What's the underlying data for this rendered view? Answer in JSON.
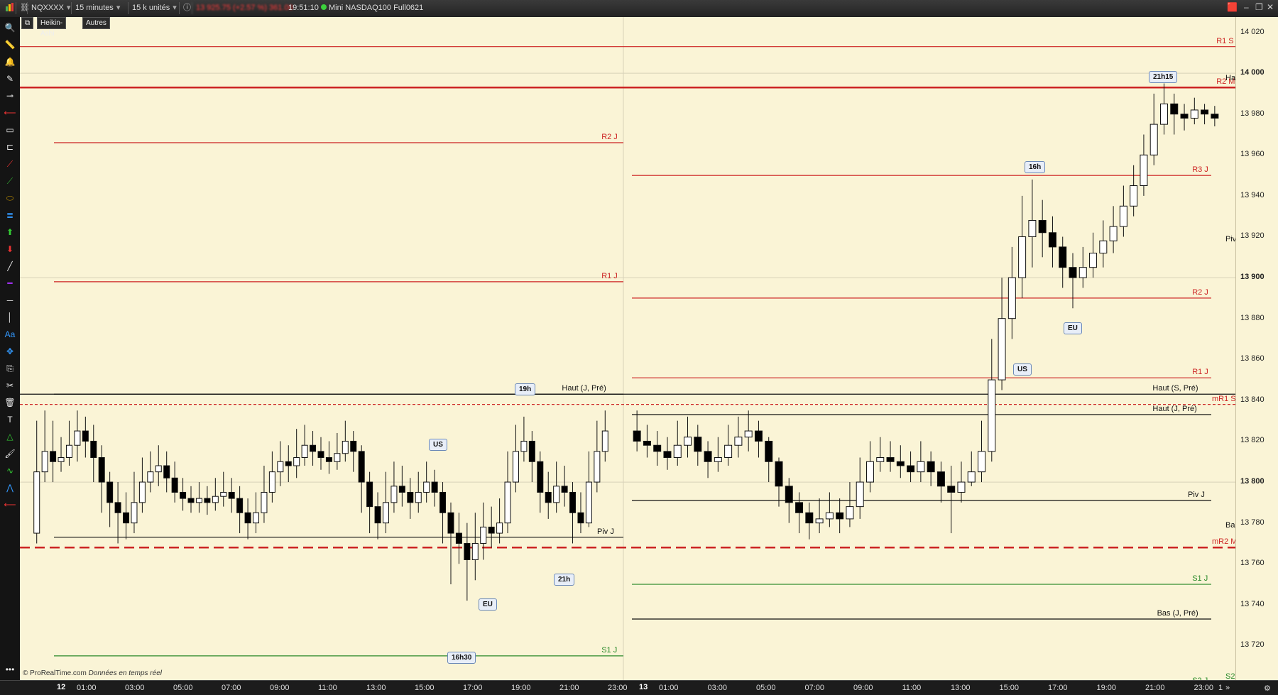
{
  "topbar": {
    "symbol": "NQXXXX",
    "timeframe": "15 minutes",
    "units": "15 k unités",
    "info_icon": "info-icon",
    "price_blur": "13 925.75 (+2.57 %) 361.00",
    "clock": "19:51:10",
    "instrument": "Mini NASDAQ100 Full0621"
  },
  "chart_header": {
    "mode": "Heikin-Ashi",
    "other": "Autres"
  },
  "copyright": "© ProRealTime.com",
  "copyright_note": "Données en temps réel",
  "yaxis": {
    "ticks": [
      "14 020",
      "14 000",
      "13 980",
      "13 960",
      "13 940",
      "13 920",
      "13 900",
      "13 880",
      "13 860",
      "13 840",
      "13 820",
      "13 800",
      "13 780",
      "13 760",
      "13 740",
      "13 720"
    ],
    "bold_ticks": [
      "14 000",
      "13 900",
      "13 800"
    ]
  },
  "xaxis": {
    "day1": "12",
    "day2": "13",
    "labels1": [
      "01:00",
      "03:00",
      "05:00",
      "07:00",
      "09:00",
      "11:00",
      "13:00",
      "15:00",
      "17:00",
      "19:00",
      "21:00",
      "23:00"
    ],
    "labels2": [
      "01:00",
      "03:00",
      "05:00",
      "07:00",
      "09:00",
      "11:00",
      "13:00",
      "15:00",
      "17:00",
      "19:00",
      "21:00",
      "23:00"
    ],
    "trailing": "1"
  },
  "levels": {
    "left": [
      {
        "label": "R2 J",
        "price": 13966,
        "color": "#cc2222"
      },
      {
        "label": "R1 J",
        "price": 13898,
        "color": "#cc2222"
      },
      {
        "label": "Haut (J, Pré)",
        "price": 13843,
        "color": "#111111"
      },
      {
        "label": "Piv J",
        "price": 13773,
        "color": "#111111"
      },
      {
        "label": "S1 J",
        "price": 13715,
        "color": "#2a8a2a"
      }
    ],
    "right": [
      {
        "label": "R1 S",
        "price": 14013,
        "color": "#cc2222"
      },
      {
        "label": "R2 M",
        "price": 13993,
        "color": "#cc2222"
      },
      {
        "label": "R3 J",
        "price": 13950,
        "color": "#cc2222"
      },
      {
        "label": "R2 J",
        "price": 13890,
        "color": "#cc2222"
      },
      {
        "label": "R1 J",
        "price": 13851,
        "color": "#cc2222"
      },
      {
        "label": "Haut (S, Pré)",
        "price": 13843,
        "color": "#111111"
      },
      {
        "label": "mR1 S",
        "price": 13838,
        "color": "#cc2222"
      },
      {
        "label": "Haut (J, Pré)",
        "price": 13833,
        "color": "#111111"
      },
      {
        "label": "Piv J",
        "price": 13791,
        "color": "#111111"
      },
      {
        "label": "Bas",
        "price": 13776,
        "color": "#111111"
      },
      {
        "label": "mR2 M",
        "price": 13768,
        "color": "#cc2222"
      },
      {
        "label": "S1 J",
        "price": 13750,
        "color": "#2a8a2a"
      },
      {
        "label": "Bas (J, Pré)",
        "price": 13733,
        "color": "#111111"
      },
      {
        "label": "S2 J",
        "price": 13700,
        "color": "#2a8a2a"
      },
      {
        "label": "Ha",
        "price": 13995,
        "color": "#111111"
      },
      {
        "label": "Piv",
        "price": 13916,
        "color": "#111111"
      },
      {
        "label": "S2",
        "price": 13702,
        "color": "#2a8a2a"
      }
    ]
  },
  "badges": [
    {
      "text": "19h"
    },
    {
      "text": "US"
    },
    {
      "text": "EU"
    },
    {
      "text": "16h30"
    },
    {
      "text": "21h"
    },
    {
      "text": "16h"
    },
    {
      "text": "EU"
    },
    {
      "text": "US"
    },
    {
      "text": "21h15"
    }
  ],
  "colors": {
    "background": "#faf4d6",
    "resistance": "#cc2222",
    "support": "#2a8a2a",
    "pivot": "#111111",
    "candle_up": "#ffffff",
    "candle_down": "#000000"
  },
  "chart_data": {
    "type": "candlestick",
    "ylim": [
      13708,
      14024
    ],
    "note_series": "Heikin-Ashi",
    "candles_day1": [
      [
        13775,
        13805,
        13830,
        13770
      ],
      [
        13805,
        13815,
        13835,
        13800
      ],
      [
        13815,
        13810,
        13830,
        13800
      ],
      [
        13810,
        13812,
        13822,
        13805
      ],
      [
        13812,
        13818,
        13830,
        13808
      ],
      [
        13818,
        13825,
        13835,
        13810
      ],
      [
        13825,
        13820,
        13832,
        13812
      ],
      [
        13820,
        13812,
        13828,
        13800
      ],
      [
        13812,
        13800,
        13818,
        13785
      ],
      [
        13800,
        13790,
        13805,
        13778
      ],
      [
        13790,
        13785,
        13800,
        13770
      ],
      [
        13785,
        13780,
        13795,
        13772
      ],
      [
        13780,
        13790,
        13805,
        13775
      ],
      [
        13790,
        13800,
        13812,
        13785
      ],
      [
        13800,
        13805,
        13815,
        13795
      ],
      [
        13805,
        13808,
        13818,
        13798
      ],
      [
        13808,
        13802,
        13815,
        13795
      ],
      [
        13802,
        13795,
        13810,
        13790
      ],
      [
        13795,
        13792,
        13802,
        13786
      ],
      [
        13792,
        13790,
        13798,
        13785
      ],
      [
        13790,
        13792,
        13800,
        13785
      ],
      [
        13792,
        13790,
        13798,
        13784
      ],
      [
        13790,
        13793,
        13802,
        13786
      ],
      [
        13793,
        13795,
        13805,
        13788
      ],
      [
        13795,
        13792,
        13802,
        13785
      ],
      [
        13792,
        13785,
        13798,
        13775
      ],
      [
        13785,
        13780,
        13792,
        13772
      ],
      [
        13780,
        13785,
        13795,
        13775
      ],
      [
        13785,
        13795,
        13808,
        13780
      ],
      [
        13795,
        13805,
        13815,
        13790
      ],
      [
        13805,
        13810,
        13820,
        13798
      ],
      [
        13810,
        13808,
        13818,
        13800
      ],
      [
        13808,
        13812,
        13826,
        13802
      ],
      [
        13812,
        13818,
        13828,
        13808
      ],
      [
        13818,
        13815,
        13825,
        13808
      ],
      [
        13815,
        13812,
        13822,
        13806
      ],
      [
        13812,
        13810,
        13820,
        13804
      ],
      [
        13810,
        13814,
        13824,
        13806
      ],
      [
        13814,
        13820,
        13830,
        13810
      ],
      [
        13820,
        13815,
        13825,
        13805
      ],
      [
        13815,
        13800,
        13818,
        13785
      ],
      [
        13800,
        13788,
        13805,
        13775
      ],
      [
        13788,
        13780,
        13795,
        13772
      ],
      [
        13780,
        13790,
        13805,
        13775
      ],
      [
        13790,
        13798,
        13810,
        13785
      ],
      [
        13798,
        13795,
        13808,
        13788
      ],
      [
        13795,
        13790,
        13802,
        13782
      ],
      [
        13790,
        13795,
        13805,
        13785
      ],
      [
        13795,
        13800,
        13810,
        13790
      ],
      [
        13800,
        13795,
        13806,
        13788
      ],
      [
        13795,
        13785,
        13800,
        13770
      ],
      [
        13785,
        13775,
        13790,
        13750
      ],
      [
        13775,
        13770,
        13785,
        13760
      ],
      [
        13770,
        13762,
        13780,
        13742
      ],
      [
        13762,
        13770,
        13785,
        13752
      ],
      [
        13770,
        13778,
        13790,
        13762
      ],
      [
        13778,
        13775,
        13788,
        13768
      ],
      [
        13775,
        13780,
        13792,
        13770
      ],
      [
        13780,
        13800,
        13815,
        13775
      ],
      [
        13800,
        13815,
        13828,
        13795
      ],
      [
        13815,
        13820,
        13832,
        13810
      ],
      [
        13820,
        13810,
        13825,
        13800
      ],
      [
        13810,
        13795,
        13815,
        13785
      ],
      [
        13795,
        13790,
        13805,
        13782
      ],
      [
        13790,
        13798,
        13810,
        13785
      ],
      [
        13798,
        13795,
        13808,
        13788
      ],
      [
        13795,
        13785,
        13800,
        13770
      ],
      [
        13785,
        13780,
        13795,
        13775
      ],
      [
        13780,
        13800,
        13815,
        13778
      ],
      [
        13800,
        13815,
        13830,
        13795
      ],
      [
        13815,
        13825,
        13835,
        13810
      ]
    ],
    "candles_day2": [
      [
        13825,
        13820,
        13835,
        13815
      ],
      [
        13820,
        13818,
        13828,
        13812
      ],
      [
        13818,
        13815,
        13825,
        13808
      ],
      [
        13815,
        13812,
        13822,
        13806
      ],
      [
        13812,
        13818,
        13830,
        13808
      ],
      [
        13818,
        13822,
        13832,
        13812
      ],
      [
        13822,
        13815,
        13828,
        13808
      ],
      [
        13815,
        13810,
        13820,
        13802
      ],
      [
        13810,
        13812,
        13822,
        13805
      ],
      [
        13812,
        13818,
        13828,
        13808
      ],
      [
        13818,
        13822,
        13832,
        13812
      ],
      [
        13822,
        13825,
        13835,
        13815
      ],
      [
        13825,
        13820,
        13830,
        13812
      ],
      [
        13820,
        13810,
        13822,
        13800
      ],
      [
        13810,
        13798,
        13812,
        13788
      ],
      [
        13798,
        13790,
        13802,
        13780
      ],
      [
        13790,
        13785,
        13795,
        13775
      ],
      [
        13785,
        13780,
        13790,
        13772
      ],
      [
        13780,
        13782,
        13792,
        13775
      ],
      [
        13782,
        13785,
        13795,
        13778
      ],
      [
        13785,
        13782,
        13792,
        13775
      ],
      [
        13782,
        13788,
        13800,
        13778
      ],
      [
        13788,
        13800,
        13812,
        13782
      ],
      [
        13800,
        13810,
        13820,
        13795
      ],
      [
        13810,
        13812,
        13822,
        13805
      ],
      [
        13812,
        13810,
        13820,
        13805
      ],
      [
        13810,
        13808,
        13818,
        13802
      ],
      [
        13808,
        13805,
        13815,
        13800
      ],
      [
        13805,
        13810,
        13820,
        13800
      ],
      [
        13810,
        13805,
        13815,
        13798
      ],
      [
        13805,
        13798,
        13810,
        13790
      ],
      [
        13798,
        13795,
        13808,
        13775
      ],
      [
        13795,
        13800,
        13810,
        13790
      ],
      [
        13800,
        13805,
        13815,
        13798
      ],
      [
        13805,
        13815,
        13830,
        13800
      ],
      [
        13815,
        13850,
        13870,
        13810
      ],
      [
        13850,
        13880,
        13900,
        13845
      ],
      [
        13880,
        13900,
        13915,
        13870
      ],
      [
        13900,
        13920,
        13940,
        13890
      ],
      [
        13920,
        13928,
        13948,
        13905
      ],
      [
        13928,
        13922,
        13938,
        13910
      ],
      [
        13922,
        13915,
        13930,
        13905
      ],
      [
        13915,
        13905,
        13920,
        13895
      ],
      [
        13905,
        13900,
        13912,
        13885
      ],
      [
        13900,
        13905,
        13915,
        13895
      ],
      [
        13905,
        13912,
        13922,
        13900
      ],
      [
        13912,
        13918,
        13928,
        13905
      ],
      [
        13918,
        13925,
        13935,
        13912
      ],
      [
        13925,
        13935,
        13945,
        13920
      ],
      [
        13935,
        13945,
        13955,
        13930
      ],
      [
        13945,
        13960,
        13970,
        13940
      ],
      [
        13960,
        13975,
        13990,
        13955
      ],
      [
        13975,
        13985,
        13995,
        13970
      ],
      [
        13985,
        13980,
        13990,
        13970
      ],
      [
        13980,
        13978,
        13985,
        13972
      ],
      [
        13978,
        13982,
        13988,
        13975
      ],
      [
        13982,
        13980,
        13985,
        13975
      ],
      [
        13980,
        13978,
        13984,
        13974
      ]
    ]
  }
}
